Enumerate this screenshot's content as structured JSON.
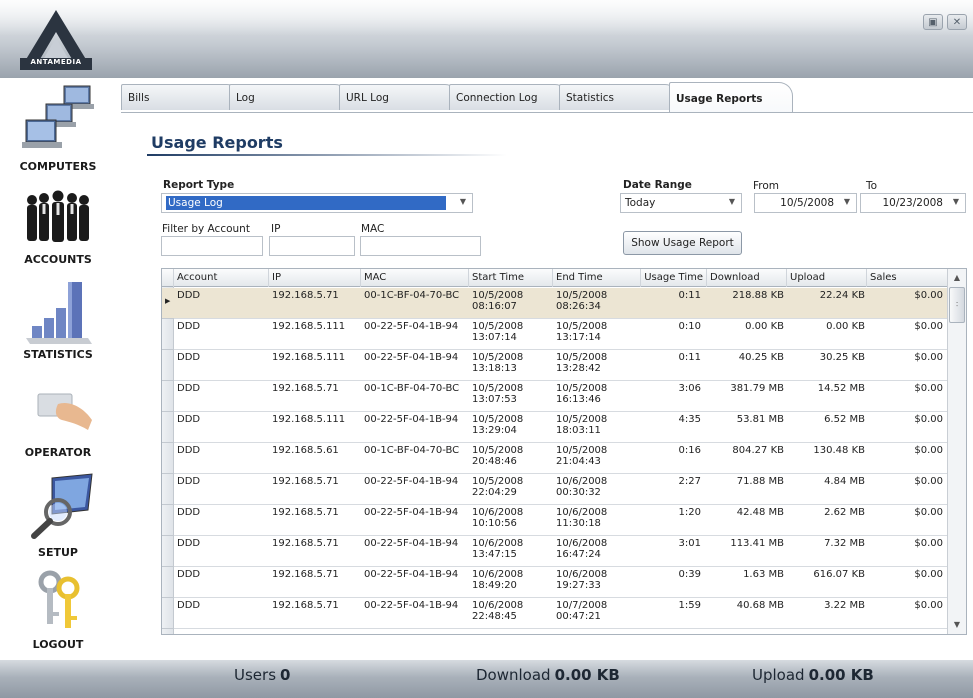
{
  "app": {
    "logo_text": "ANTAMEDIA",
    "window_buttons": [
      "restore-icon",
      "close-icon"
    ]
  },
  "sidebar": {
    "items": [
      {
        "label": "COMPUTERS",
        "icon": "computers-icon"
      },
      {
        "label": "ACCOUNTS",
        "icon": "accounts-icon"
      },
      {
        "label": "STATISTICS",
        "icon": "statistics-icon"
      },
      {
        "label": "OPERATOR",
        "icon": "operator-icon"
      },
      {
        "label": "SETUP",
        "icon": "setup-icon"
      },
      {
        "label": "LOGOUT",
        "icon": "logout-icon"
      }
    ]
  },
  "tabs": [
    {
      "label": "Bills"
    },
    {
      "label": "Log"
    },
    {
      "label": "URL Log"
    },
    {
      "label": "Connection Log"
    },
    {
      "label": "Statistics"
    },
    {
      "label": "Usage Reports",
      "active": true
    }
  ],
  "main": {
    "title": "Usage Reports",
    "report_type_label": "Report Type",
    "report_type_value": "Usage Log",
    "date_range_label": "Date Range",
    "date_range_value": "Today",
    "from_label": "From",
    "from_value": "10/5/2008",
    "to_label": "To",
    "to_value": "10/23/2008",
    "filter_label": "Filter by Account",
    "ip_label": "IP",
    "mac_label": "MAC",
    "show_button": "Show Usage Report"
  },
  "grid": {
    "columns": [
      "Account",
      "IP",
      "MAC",
      "Start Time",
      "End Time",
      "Usage Time",
      "Download",
      "Upload",
      "Sales"
    ],
    "rows": [
      {
        "account": "DDD",
        "ip": "192.168.5.71",
        "mac": "00-1C-BF-04-70-BC",
        "start_date": "10/5/2008",
        "start_time": "08:16:07",
        "end_date": "10/5/2008",
        "end_time": "08:26:34",
        "usage": "0:11",
        "download": "218.88 KB",
        "upload": "22.24 KB",
        "sales": "$0.00"
      },
      {
        "account": "DDD",
        "ip": "192.168.5.111",
        "mac": "00-22-5F-04-1B-94",
        "start_date": "10/5/2008",
        "start_time": "13:07:14",
        "end_date": "10/5/2008",
        "end_time": "13:17:14",
        "usage": "0:10",
        "download": "0.00 KB",
        "upload": "0.00 KB",
        "sales": "$0.00"
      },
      {
        "account": "DDD",
        "ip": "192.168.5.111",
        "mac": "00-22-5F-04-1B-94",
        "start_date": "10/5/2008",
        "start_time": "13:18:13",
        "end_date": "10/5/2008",
        "end_time": "13:28:42",
        "usage": "0:11",
        "download": "40.25 KB",
        "upload": "30.25 KB",
        "sales": "$0.00"
      },
      {
        "account": "DDD",
        "ip": "192.168.5.71",
        "mac": "00-1C-BF-04-70-BC",
        "start_date": "10/5/2008",
        "start_time": "13:07:53",
        "end_date": "10/5/2008",
        "end_time": "16:13:46",
        "usage": "3:06",
        "download": "381.79 MB",
        "upload": "14.52 MB",
        "sales": "$0.00"
      },
      {
        "account": "DDD",
        "ip": "192.168.5.111",
        "mac": "00-22-5F-04-1B-94",
        "start_date": "10/5/2008",
        "start_time": "13:29:04",
        "end_date": "10/5/2008",
        "end_time": "18:03:11",
        "usage": "4:35",
        "download": "53.81 MB",
        "upload": "6.52 MB",
        "sales": "$0.00"
      },
      {
        "account": "DDD",
        "ip": "192.168.5.61",
        "mac": "00-1C-BF-04-70-BC",
        "start_date": "10/5/2008",
        "start_time": "20:48:46",
        "end_date": "10/5/2008",
        "end_time": "21:04:43",
        "usage": "0:16",
        "download": "804.27 KB",
        "upload": "130.48 KB",
        "sales": "$0.00"
      },
      {
        "account": "DDD",
        "ip": "192.168.5.71",
        "mac": "00-22-5F-04-1B-94",
        "start_date": "10/5/2008",
        "start_time": "22:04:29",
        "end_date": "10/6/2008",
        "end_time": "00:30:32",
        "usage": "2:27",
        "download": "71.88 MB",
        "upload": "4.84 MB",
        "sales": "$0.00"
      },
      {
        "account": "DDD",
        "ip": "192.168.5.71",
        "mac": "00-22-5F-04-1B-94",
        "start_date": "10/6/2008",
        "start_time": "10:10:56",
        "end_date": "10/6/2008",
        "end_time": "11:30:18",
        "usage": "1:20",
        "download": "42.48 MB",
        "upload": "2.62 MB",
        "sales": "$0.00"
      },
      {
        "account": "DDD",
        "ip": "192.168.5.71",
        "mac": "00-22-5F-04-1B-94",
        "start_date": "10/6/2008",
        "start_time": "13:47:15",
        "end_date": "10/6/2008",
        "end_time": "16:47:24",
        "usage": "3:01",
        "download": "113.41 MB",
        "upload": "7.32 MB",
        "sales": "$0.00"
      },
      {
        "account": "DDD",
        "ip": "192.168.5.71",
        "mac": "00-22-5F-04-1B-94",
        "start_date": "10/6/2008",
        "start_time": "18:49:20",
        "end_date": "10/6/2008",
        "end_time": "19:27:33",
        "usage": "0:39",
        "download": "1.63 MB",
        "upload": "616.07 KB",
        "sales": "$0.00"
      },
      {
        "account": "DDD",
        "ip": "192.168.5.71",
        "mac": "00-22-5F-04-1B-94",
        "start_date": "10/6/2008",
        "start_time": "22:48:45",
        "end_date": "10/7/2008",
        "end_time": "00:47:21",
        "usage": "1:59",
        "download": "40.68 MB",
        "upload": "3.22 MB",
        "sales": "$0.00"
      }
    ]
  },
  "status": {
    "users_label": "Users",
    "users_value": "0",
    "download_label": "Download",
    "download_value": "0.00 KB",
    "upload_label": "Upload",
    "upload_value": "0.00 KB"
  }
}
